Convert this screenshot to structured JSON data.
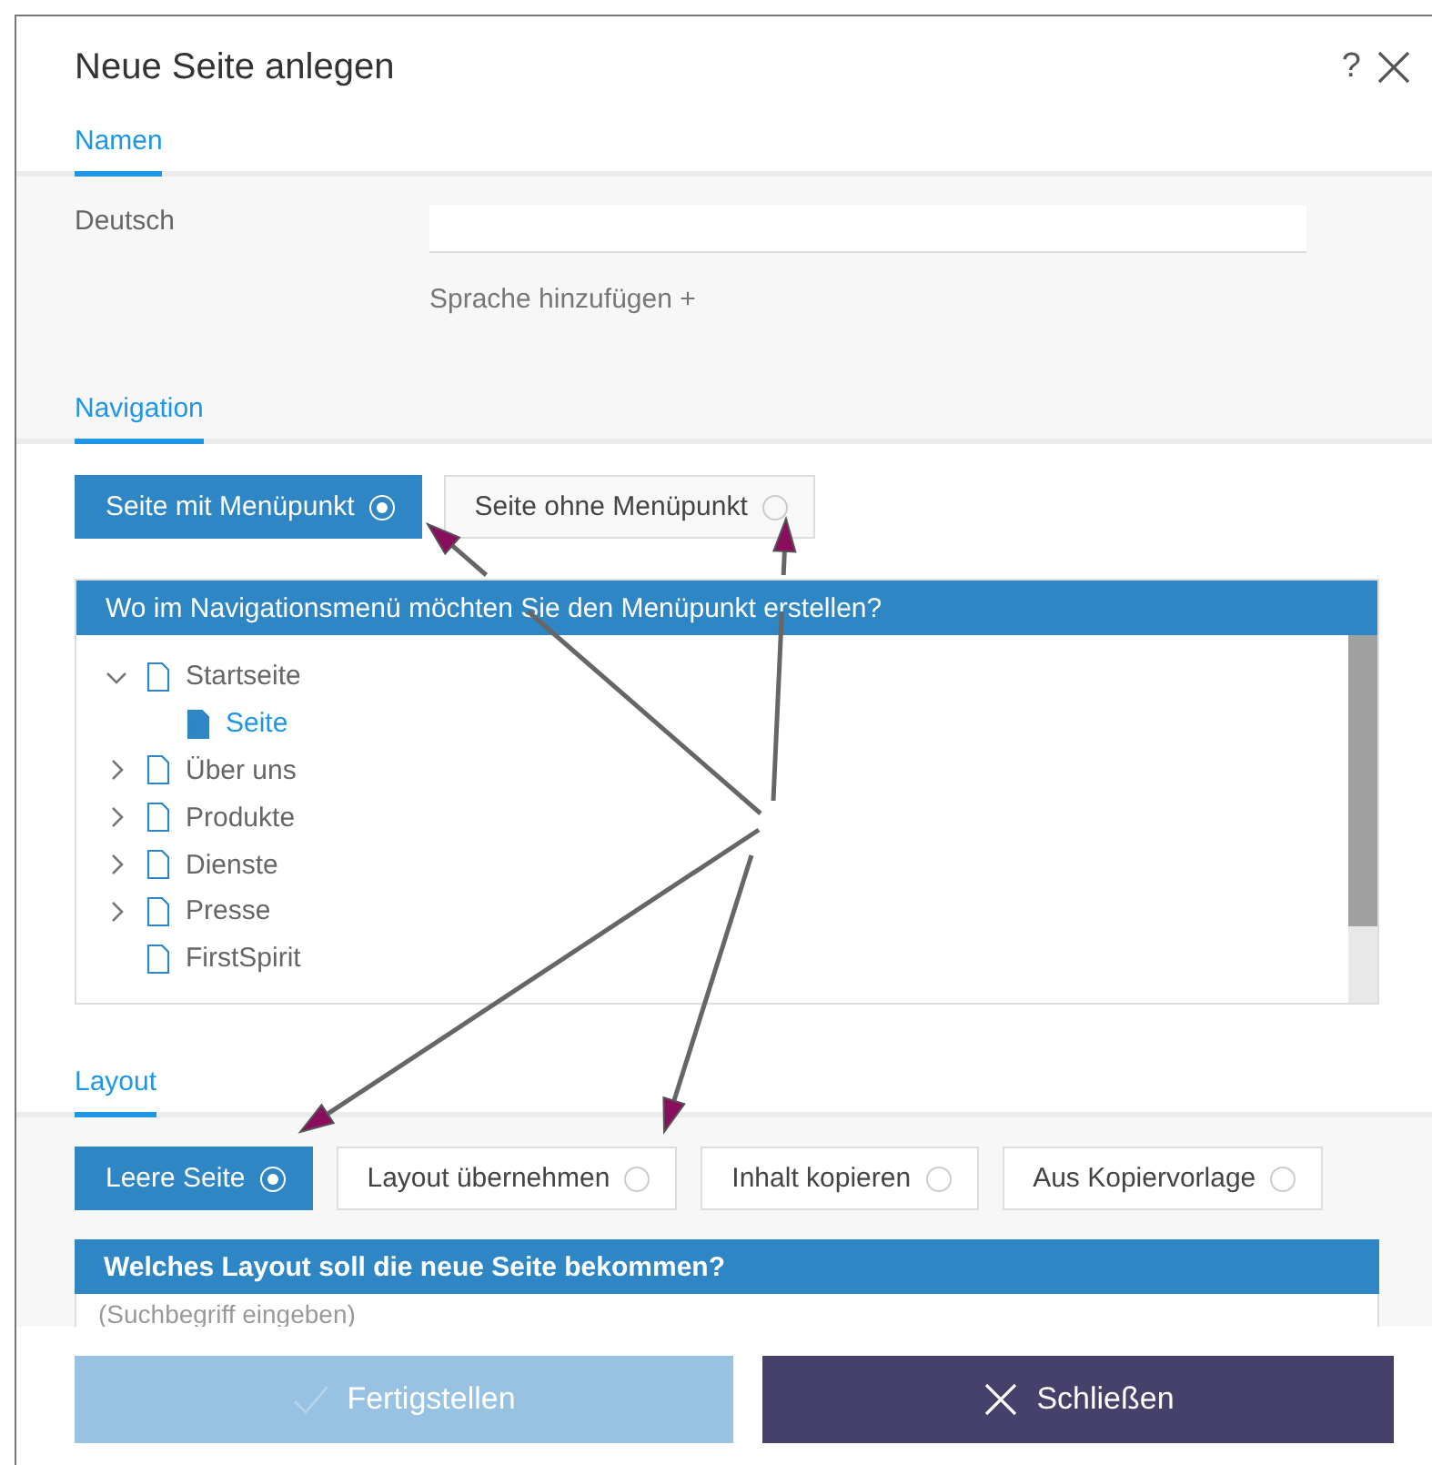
{
  "dialog": {
    "title": "Neue Seite anlegen",
    "help": "?"
  },
  "names_section": {
    "tab": "Namen",
    "language_label": "Deutsch",
    "add_language": "Sprache hinzufügen +"
  },
  "navigation_section": {
    "tab": "Navigation",
    "options": [
      {
        "label": "Seite mit Menüpunkt",
        "selected": true
      },
      {
        "label": "Seite ohne Menüpunkt",
        "selected": false
      }
    ],
    "tree_title": "Wo im Navigationsmenü möchten Sie den Menüpunkt erstellen?",
    "tree": [
      {
        "label": "Startseite",
        "kind": "branch",
        "expanded": true,
        "selected": false,
        "children": [
          {
            "label": "Seite",
            "kind": "leaf",
            "selected": true
          }
        ]
      },
      {
        "label": "Über uns",
        "kind": "branch",
        "expanded": false,
        "selected": false
      },
      {
        "label": "Produkte",
        "kind": "branch",
        "expanded": false,
        "selected": false
      },
      {
        "label": "Dienste",
        "kind": "branch",
        "expanded": false,
        "selected": false
      },
      {
        "label": "Presse",
        "kind": "branch",
        "expanded": false,
        "selected": false
      },
      {
        "label": "FirstSpirit",
        "kind": "leaf",
        "selected": false
      }
    ]
  },
  "layout_section": {
    "tab": "Layout",
    "options": [
      {
        "label": "Leere Seite",
        "selected": true
      },
      {
        "label": "Layout übernehmen",
        "selected": false
      },
      {
        "label": "Inhalt kopieren",
        "selected": false
      },
      {
        "label": "Aus Kopiervorlage",
        "selected": false
      }
    ],
    "list_title": "Welches Layout soll die neue Seite bekommen?",
    "search": {
      "placeholder": "(Suchbegriff eingeben)"
    }
  },
  "footer": [
    {
      "label": "Fertigstellen",
      "kind": "confirm",
      "disabled": true
    },
    {
      "label": "Schließen",
      "kind": "close",
      "disabled": false
    }
  ]
}
